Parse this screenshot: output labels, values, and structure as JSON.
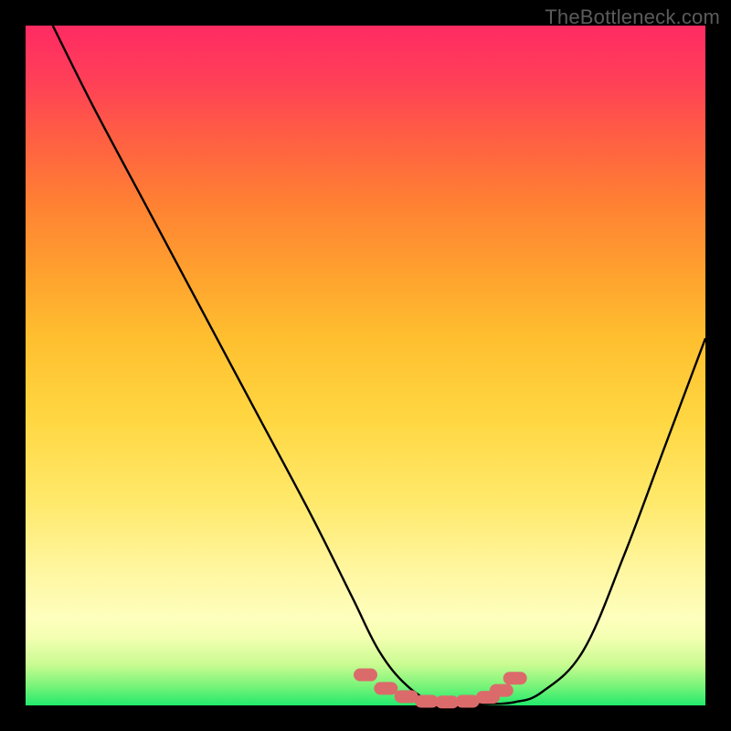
{
  "watermark": "TheBottleneck.com",
  "colors": {
    "dot": "#db6b6b",
    "curve": "#000000",
    "frame": "#000000"
  },
  "chart_data": {
    "type": "line",
    "title": "",
    "xlabel": "",
    "ylabel": "",
    "xlim": [
      0,
      100
    ],
    "ylim": [
      0,
      100
    ],
    "grid": false,
    "legend": false,
    "series": [
      {
        "name": "bottleneck-curve",
        "x": [
          4,
          10,
          18,
          26,
          34,
          42,
          48,
          52,
          56,
          60,
          64,
          68,
          72,
          76,
          82,
          88,
          94,
          100
        ],
        "y": [
          100,
          88,
          73,
          58,
          43,
          28,
          16,
          8,
          3,
          0.5,
          0.2,
          0.2,
          0.5,
          2,
          8,
          22,
          38,
          54
        ]
      }
    ],
    "highlight_points": {
      "name": "optimal-range",
      "x": [
        50,
        53,
        56,
        59,
        62,
        65,
        68,
        70,
        72
      ],
      "y": [
        4.5,
        2.5,
        1.3,
        0.6,
        0.5,
        0.6,
        1.2,
        2.2,
        4.0
      ]
    }
  }
}
